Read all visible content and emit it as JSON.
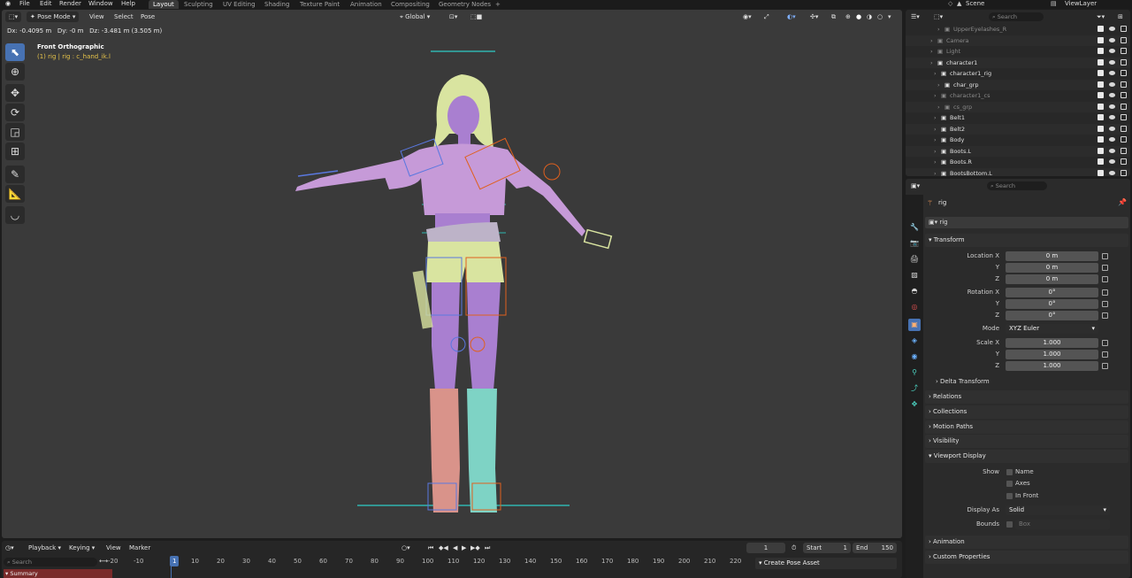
{
  "topbar": {
    "menus": [
      "File",
      "Edit",
      "Render",
      "Window",
      "Help"
    ],
    "workspaces": [
      "Layout",
      "Sculpting",
      "UV Editing",
      "Shading",
      "Texture Paint",
      "Animation",
      "Compositing",
      "Geometry Nodes",
      "+"
    ],
    "active_workspace": "Layout",
    "scene": "Scene",
    "view_layer": "ViewLayer"
  },
  "viewport": {
    "mode": "Pose Mode",
    "menus": [
      "View",
      "Select",
      "Pose"
    ],
    "transform_orientation": "Global",
    "status_text": "Dx: -0.4095 m   Dy: -0 m   Dz: -3.481 m (3.505 m)",
    "view_name": "Front Orthographic",
    "active_info": "(1) rig | rig : c_hand_ik.l"
  },
  "timeline": {
    "menus": [
      "Playback",
      "Keying",
      "View",
      "Marker"
    ],
    "current_frame": "1",
    "start_label": "Start",
    "start_value": "1",
    "end_label": "End",
    "end_value": "150",
    "search_placeholder": "Search",
    "ruler": [
      "-20",
      "-10",
      "1",
      "10",
      "20",
      "30",
      "40",
      "50",
      "60",
      "70",
      "80",
      "90",
      "100",
      "110",
      "120",
      "130",
      "140",
      "150",
      "160",
      "170",
      "180",
      "190",
      "200",
      "210",
      "220"
    ],
    "summary_label": "Summary",
    "pose_asset_button": "Create Pose Asset"
  },
  "outliner": {
    "search_placeholder": "Search",
    "rows": [
      {
        "name": "UpperEyelashes_R",
        "dim": true
      },
      {
        "name": "Camera",
        "dim": true
      },
      {
        "name": "Light",
        "dim": true
      },
      {
        "name": "character1",
        "dim": false
      },
      {
        "name": "character1_rig",
        "dim": false
      },
      {
        "name": "char_grp",
        "dim": false
      },
      {
        "name": "character1_cs",
        "dim": true
      },
      {
        "name": "cs_grp",
        "dim": true
      },
      {
        "name": "Belt1",
        "dim": false
      },
      {
        "name": "Belt2",
        "dim": false
      },
      {
        "name": "Body",
        "dim": false
      },
      {
        "name": "Boots.L",
        "dim": false
      },
      {
        "name": "Boots.R",
        "dim": false
      },
      {
        "name": "BootsBottom.L",
        "dim": false
      }
    ]
  },
  "properties": {
    "search_placeholder": "Search",
    "object_name": "rig",
    "object_field": "rig",
    "transform": {
      "header": "Transform",
      "location_x_label": "Location X",
      "location_x": "0 m",
      "location_y_label": "Y",
      "location_y": "0 m",
      "location_z_label": "Z",
      "location_z": "0 m",
      "rotation_x_label": "Rotation X",
      "rotation_x": "0°",
      "rotation_y_label": "Y",
      "rotation_y": "0°",
      "rotation_z_label": "Z",
      "rotation_z": "0°",
      "mode_label": "Mode",
      "mode": "XYZ Euler",
      "scale_x_label": "Scale X",
      "scale_x": "1.000",
      "scale_y_label": "Y",
      "scale_y": "1.000",
      "scale_z_label": "Z",
      "scale_z": "1.000",
      "delta": "Delta Transform"
    },
    "panels": [
      "Relations",
      "Collections",
      "Motion Paths",
      "Visibility"
    ],
    "viewport_display": {
      "header": "Viewport Display",
      "show_label": "Show",
      "name": "Name",
      "axes": "Axes",
      "in_front": "In Front",
      "display_as_label": "Display As",
      "display_as": "Solid",
      "bounds_label": "Bounds",
      "bounds_value": "Box"
    },
    "bottom_panels": [
      "Animation",
      "Custom Properties"
    ]
  },
  "colors": {
    "accent": "#4772b3",
    "viewport_bg": "#3a3a3a",
    "skin": "#b07ac8",
    "hair": "#d9e4a0",
    "bone_orange": "#e0601e",
    "bone_cyan": "#2fb5b0",
    "bone_blue": "#5a78e0",
    "summary_red": "#7a2b2b"
  }
}
